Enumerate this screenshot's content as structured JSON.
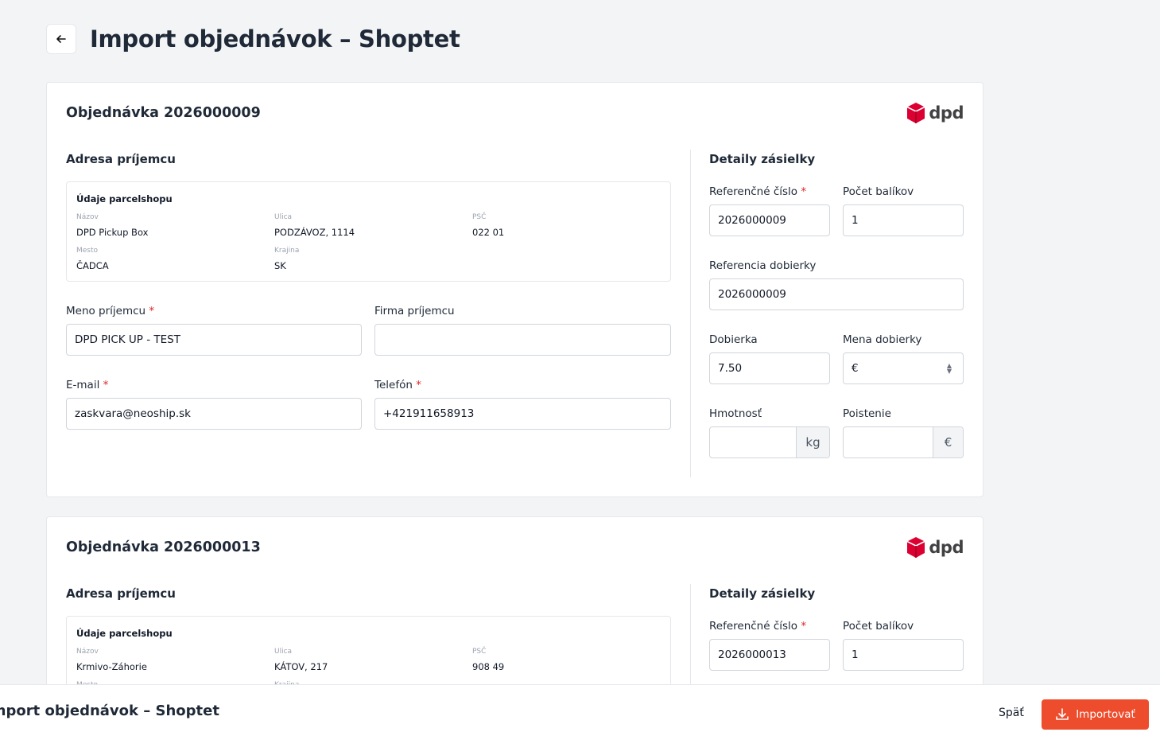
{
  "page": {
    "title": "Import objednávok – Shoptet",
    "back_icon": "arrow-left-icon"
  },
  "brand": {
    "name": "dpd",
    "color": "#dc0032"
  },
  "orders": [
    {
      "title": "Objednávka 2026000009",
      "recipient_section": "Adresa príjemcu",
      "parcelshop": {
        "heading": "Údaje parcelshopu",
        "name_label": "Názov",
        "name": "DPD Pickup Box",
        "street_label": "Ulica",
        "street": "PODZÁVOZ, 1114",
        "zip_label": "PSČ",
        "zip": "022 01",
        "city_label": "Mesto",
        "city": "ČADCA",
        "country_label": "Krajina",
        "country": "SK"
      },
      "recipient_name_label": "Meno príjemcu",
      "recipient_name": "DPD PICK UP - TEST",
      "company_label": "Firma príjemcu",
      "company": "",
      "email_label": "E-mail",
      "email": "zaskvara@neoship.sk",
      "phone_label": "Telefón",
      "phone": "+421911658913",
      "details_section": "Detaily zásielky",
      "ref_label": "Referenčné číslo",
      "ref": "2026000009",
      "packages_label": "Počet balíkov",
      "packages": "1",
      "cod_ref_label": "Referencia dobierky",
      "cod_ref": "2026000009",
      "cod_label": "Dobierka",
      "cod": "7.50",
      "currency_label": "Mena dobierky",
      "currency": "€",
      "weight_label": "Hmotnosť",
      "weight": "",
      "weight_unit": "kg",
      "insurance_label": "Poistenie",
      "insurance": "",
      "insurance_unit": "€"
    },
    {
      "title": "Objednávka 2026000013",
      "recipient_section": "Adresa príjemcu",
      "parcelshop": {
        "heading": "Údaje parcelshopu",
        "name_label": "Názov",
        "name": "Krmivo-Záhorie",
        "street_label": "Ulica",
        "street": "KÁTOV, 217",
        "zip_label": "PSČ",
        "zip": "908 49",
        "city_label": "Mesto",
        "country_label": "Krajina"
      },
      "details_section": "Detaily zásielky",
      "ref_label": "Referenčné číslo",
      "ref": "2026000013",
      "packages_label": "Počet balíkov",
      "packages": "1"
    }
  ],
  "footer": {
    "title": "Import objednávok – Shoptet",
    "back_label": "Späť",
    "import_label": "Importovať",
    "import_icon": "download-icon",
    "accent": "#ee4d2d"
  }
}
